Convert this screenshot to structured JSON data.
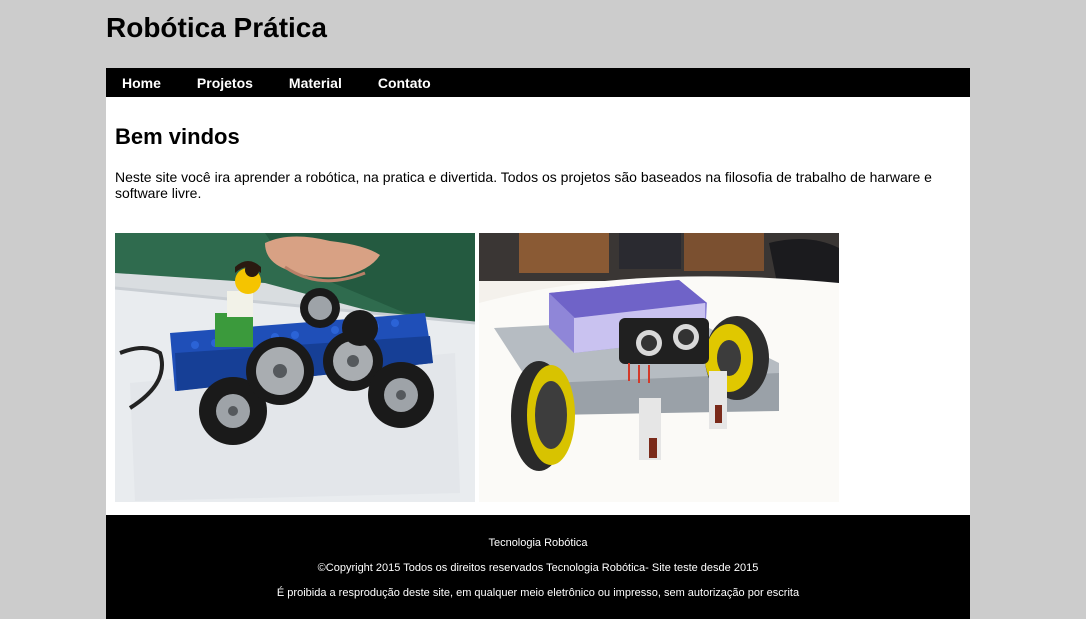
{
  "header": {
    "site_title": "Robótica Prática"
  },
  "nav": {
    "items": [
      {
        "label": "Home"
      },
      {
        "label": "Projetos"
      },
      {
        "label": "Material"
      },
      {
        "label": "Contato"
      }
    ]
  },
  "main": {
    "heading": "Bem vindos",
    "intro": "Neste site você ira aprender a robótica, na pratica e divertida. Todos os projetos são baseados na filosofia de trabalho de harware e software livre."
  },
  "footer": {
    "line1": "Tecnologia Robótica",
    "line2": "©Copyright 2015 Todos os direitos reservados Tecnologia Robótica- Site teste desde 2015",
    "line3": "É proibida a resprodução deste site, em qualquer meio eletrônico ou impresso, sem autorização por escrita"
  },
  "colors": {
    "page_background": "#cccccc",
    "nav_background": "#000000",
    "content_background": "#ffffff",
    "footer_background": "#000000"
  }
}
